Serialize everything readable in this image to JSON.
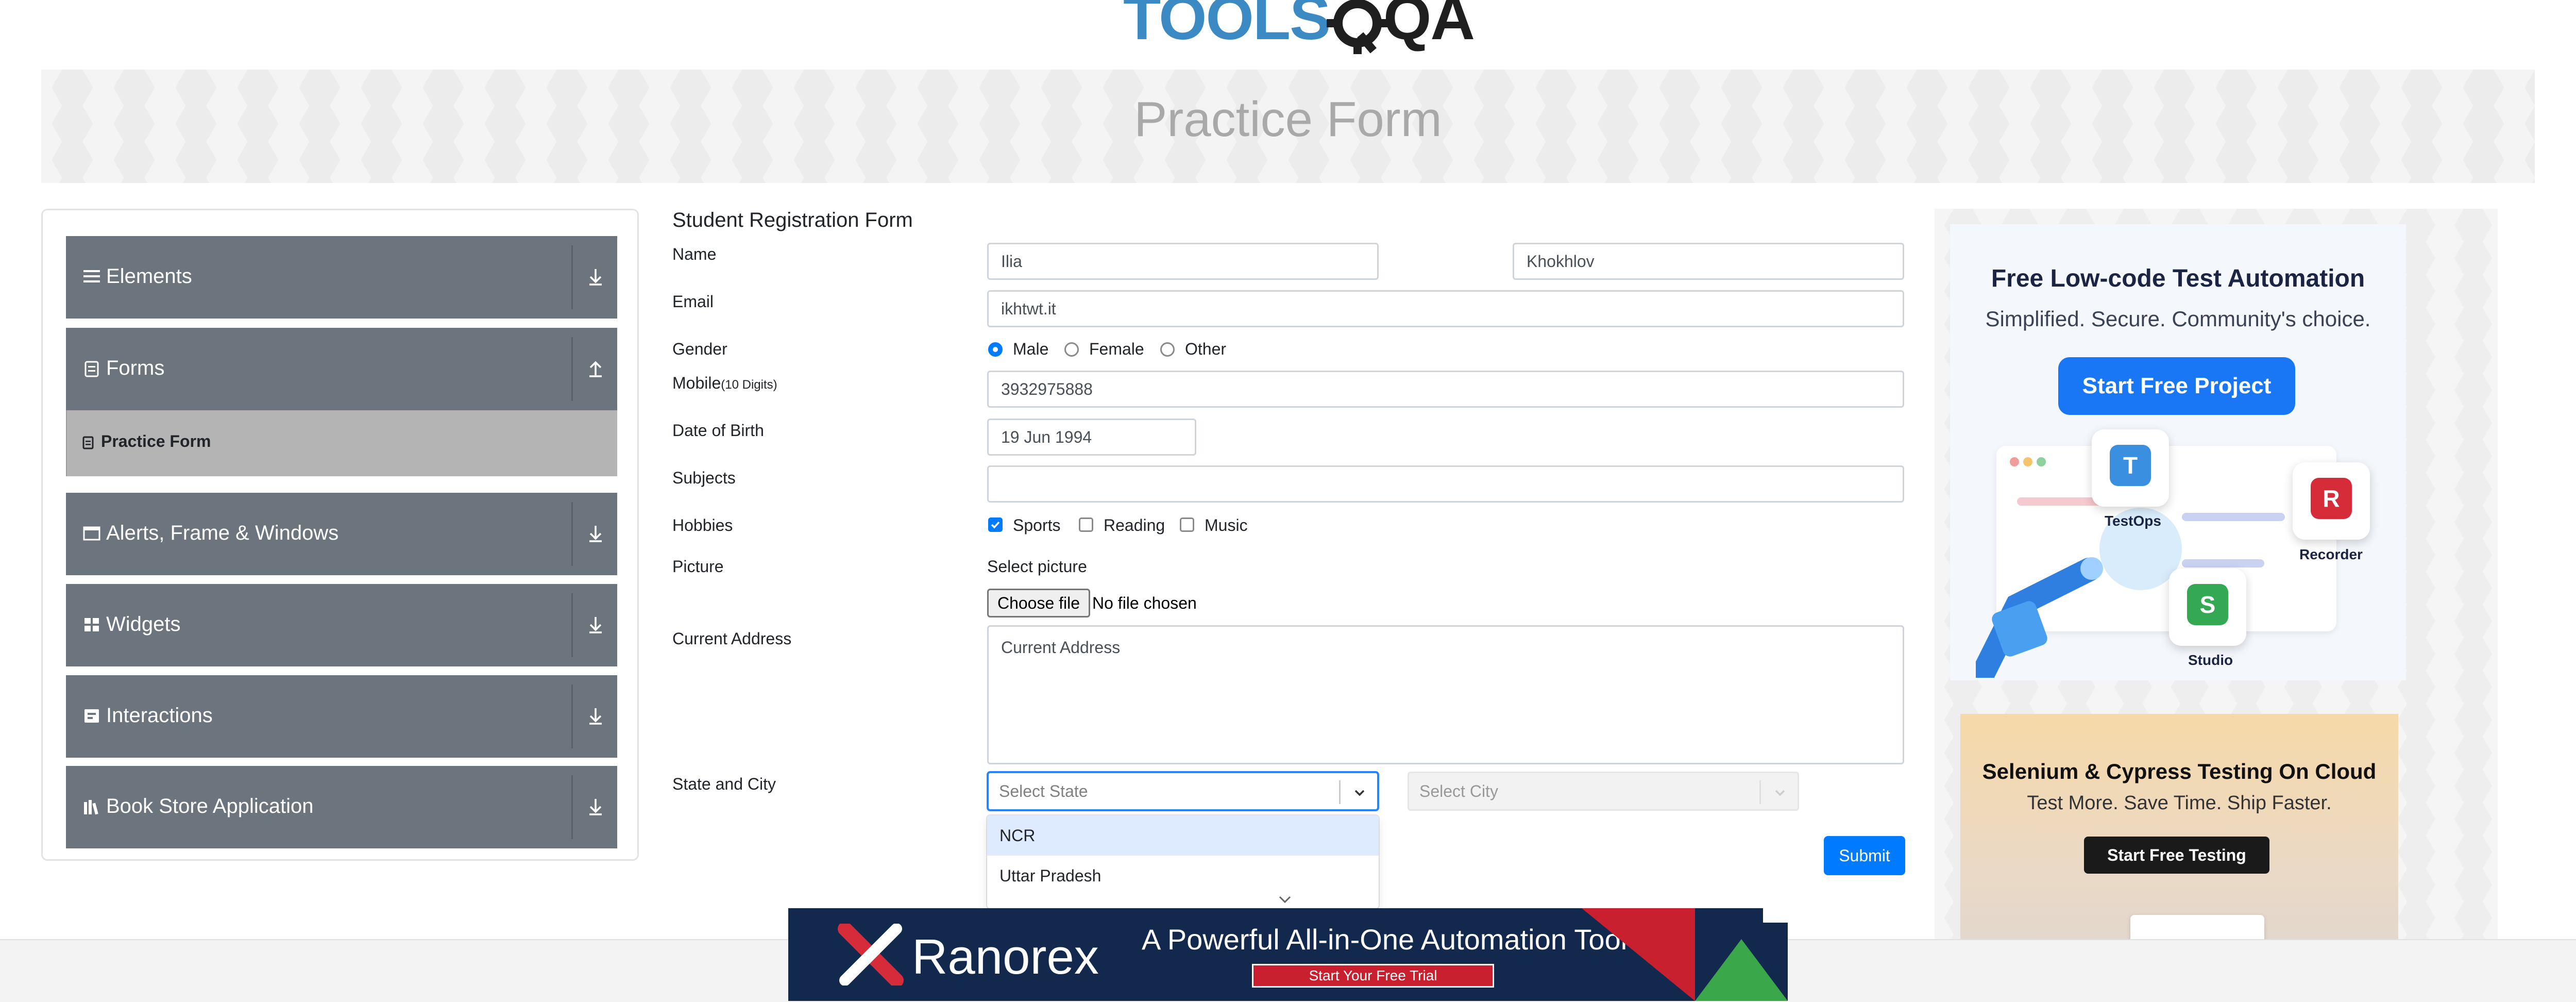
{
  "header": {
    "logo_text": "TOOLS",
    "logo_suffix": "QA",
    "banner_title": "Practice Form"
  },
  "sidebar": {
    "groups": [
      {
        "label": "Elements",
        "icon": "hamburger-icon",
        "arrow": "download-arrow-icon"
      },
      {
        "label": "Forms",
        "icon": "form-icon",
        "arrow": "upload-arrow-icon",
        "expanded": true
      },
      {
        "label": "Alerts, Frame & Windows",
        "icon": "window-icon",
        "arrow": "download-arrow-icon"
      },
      {
        "label": "Widgets",
        "icon": "grid-icon",
        "arrow": "download-arrow-icon"
      },
      {
        "label": "Interactions",
        "icon": "interaction-icon",
        "arrow": "download-arrow-icon"
      },
      {
        "label": "Book Store Application",
        "icon": "book-icon",
        "arrow": "download-arrow-icon"
      }
    ],
    "active_item": {
      "label": "Practice Form",
      "icon": "document-icon"
    }
  },
  "form": {
    "title": "Student Registration Form",
    "labels": {
      "name": "Name",
      "email": "Email",
      "gender": "Gender",
      "mobile": "Mobile",
      "mobile_hint": "(10 Digits)",
      "dob": "Date of Birth",
      "subjects": "Subjects",
      "hobbies": "Hobbies",
      "picture": "Picture",
      "address": "Current Address",
      "state_city": "State and City"
    },
    "first_name": "Ilia",
    "last_name": "Khokhlov",
    "email": "ikhtwt.it",
    "gender_options": [
      "Male",
      "Female",
      "Other"
    ],
    "gender_selected": "Male",
    "mobile": "3932975888",
    "dob": "19 Jun 1994",
    "subjects": "",
    "hobbies": [
      "Sports",
      "Reading",
      "Music"
    ],
    "hobbies_checked": [
      "Sports"
    ],
    "picture_label": "Select picture",
    "file_button": "Choose file",
    "file_status": "No file chosen",
    "address_placeholder": "Current Address",
    "state_placeholder": "Select State",
    "city_placeholder": "Select City",
    "state_options": [
      "NCR",
      "Uttar Pradesh"
    ],
    "submit": "Submit"
  },
  "ads": {
    "right_top": {
      "title": "Free Low-code Test Automation",
      "subtitle": "Simplified. Secure. Community's choice.",
      "button": "Start Free Project",
      "tiles": [
        "TestOps",
        "Recorder",
        "Studio"
      ]
    },
    "right_bottom": {
      "title": "Selenium & Cypress Testing On Cloud",
      "subtitle": "Test More. Save Time. Ship Faster.",
      "button": "Start Free Testing"
    },
    "bottom": {
      "brand": "Ranorex",
      "tagline": "A Powerful All-in-One Automation Tool",
      "button": "Start Your Free Trial"
    }
  },
  "colors": {
    "primary": "#007bff",
    "sidebar_group": "#6c757d",
    "sidebar_active": "#b4b4b4",
    "logo_blue": "#3c8ac4",
    "banner_text": "#a9a9a9"
  }
}
